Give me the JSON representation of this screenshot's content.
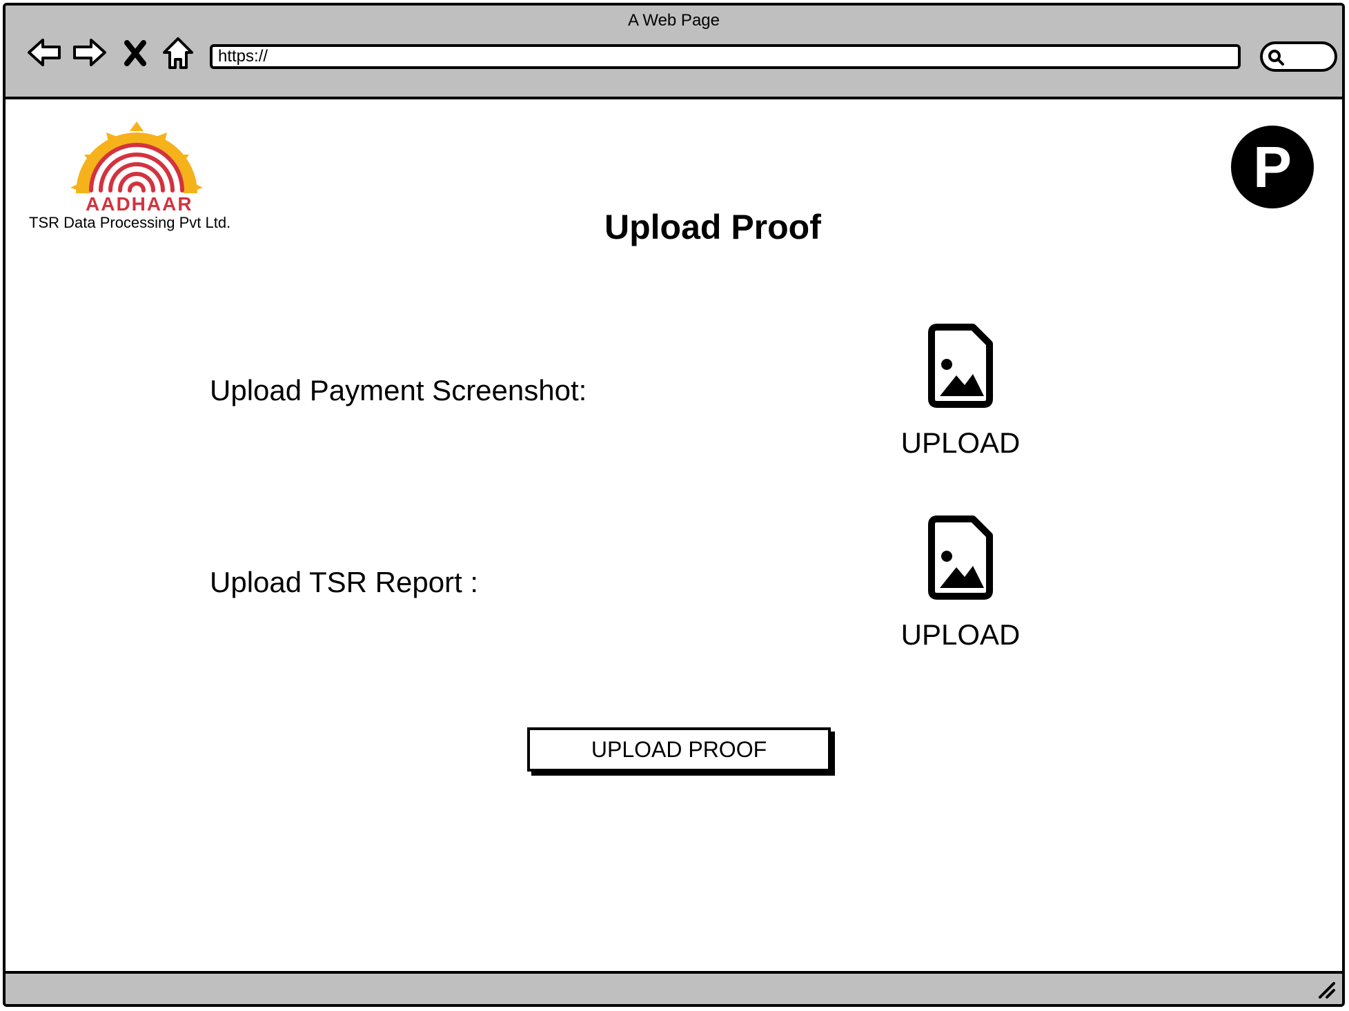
{
  "browser": {
    "window_title": "A Web Page",
    "url": "https://",
    "icons": [
      "back-arrow-icon",
      "forward-arrow-icon",
      "close-icon",
      "home-icon",
      "search-icon"
    ]
  },
  "header": {
    "logo_word": "AADHAAR",
    "company_name": "TSR Data Processing Pvt Ltd.",
    "profile_initial": "P",
    "brand_colors": {
      "fingerprint": "#d3323f",
      "sun": "#f5b21a"
    }
  },
  "main": {
    "title": "Upload Proof",
    "fields": [
      {
        "label": "Upload Payment Screenshot:",
        "upload_label": "UPLOAD",
        "icon": "image-file-icon"
      },
      {
        "label": "Upload TSR Report :",
        "upload_label": "UPLOAD",
        "icon": "image-file-icon"
      }
    ],
    "submit_label": "UPLOAD PROOF"
  }
}
